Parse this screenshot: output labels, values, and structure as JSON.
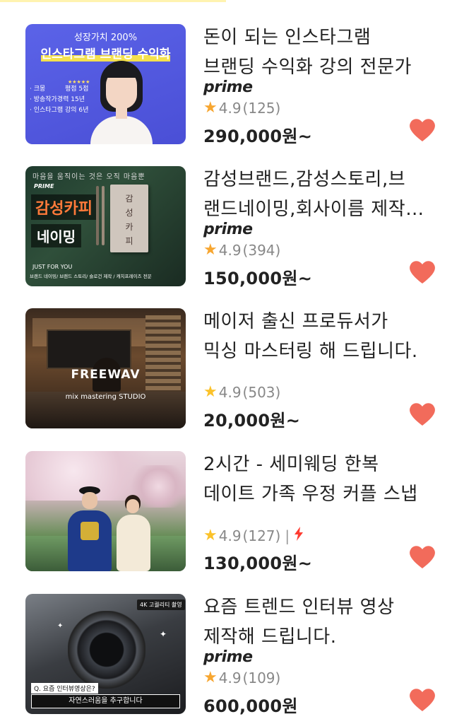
{
  "items": [
    {
      "title_lines": [
        "돈이 되는 인스타그램",
        "브랜딩 수익화 강의 전문가"
      ],
      "badge": "prime",
      "rating": "4.9",
      "reviews": "(125)",
      "price": "290,000원~",
      "thumb": {
        "headline": "성장가치 200%",
        "title": "인스타그램 브랜딩 수익화",
        "tag": "평점 5점",
        "stars": "★★★★★",
        "bullets": [
          "· 크몽",
          "· 방송작가경력 15년",
          "· 인스타그램 강의 6년"
        ]
      }
    },
    {
      "title_lines": [
        "감성브랜드,감성스토리,브",
        "랜드네이밍,회사이름 제작해 드립니다."
      ],
      "badge": "prime",
      "rating": "4.9",
      "reviews": "(394)",
      "price": "150,000원~",
      "thumb": {
        "top": "마음을 움직이는 것은 오직 마음뿐",
        "prime": "PRIME",
        "big1": "감성카피",
        "big2": "네이밍",
        "book": "감성카피",
        "just": "JUST FOR YOU",
        "sub": "브랜드 네이밍/ 브랜드 스토리/ 슬로건 제작 / 캐치프레이즈 전문"
      }
    },
    {
      "title_lines": [
        "메이저 출신 프로듀서가",
        "믹싱 마스터링 해 드립니다."
      ],
      "badge": "",
      "rating": "4.9",
      "reviews": "(503)",
      "price": "20,000원~",
      "thumb": {
        "title": "FREEWAV",
        "sub": "mix mastering STUDIO"
      }
    },
    {
      "title_lines": [
        "2시간 - 세미웨딩 한복",
        "데이트 가족 우정 커플 스냅"
      ],
      "badge": "",
      "rating": "4.9",
      "reviews": "(127)",
      "separator": "|",
      "price": "130,000원~",
      "thumb": {}
    },
    {
      "title_lines": [
        "요즘 트렌드 인터뷰 영상",
        "제작해 드립니다."
      ],
      "badge": "prime",
      "rating": "4.9",
      "reviews": "(109)",
      "price": "600,000원",
      "thumb": {
        "tag": "4K 고퀄리티 촬영",
        "q": "Q. 요즘 인터뷰영상은?",
        "a": "자연스러움을 추구합니다"
      }
    }
  ],
  "colors": {
    "heart": "#f26b5b",
    "star_orange": "#f7a630",
    "star_yellow": "#fbc22a",
    "bolt": "#ff3b30"
  }
}
